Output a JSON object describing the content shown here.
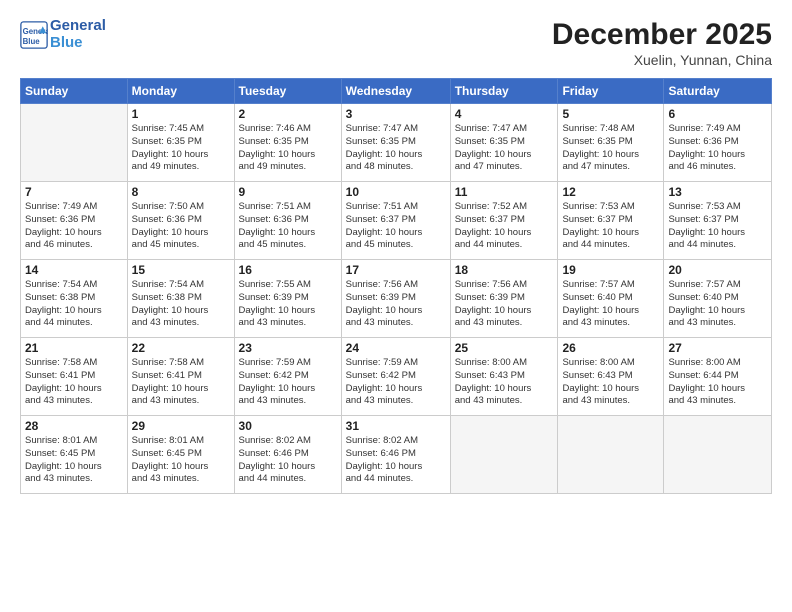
{
  "header": {
    "logo_line1": "General",
    "logo_line2": "Blue",
    "title": "December 2025",
    "location": "Xuelin, Yunnan, China"
  },
  "weekdays": [
    "Sunday",
    "Monday",
    "Tuesday",
    "Wednesday",
    "Thursday",
    "Friday",
    "Saturday"
  ],
  "weeks": [
    [
      {
        "day": "",
        "info": ""
      },
      {
        "day": "1",
        "info": "Sunrise: 7:45 AM\nSunset: 6:35 PM\nDaylight: 10 hours\nand 49 minutes."
      },
      {
        "day": "2",
        "info": "Sunrise: 7:46 AM\nSunset: 6:35 PM\nDaylight: 10 hours\nand 49 minutes."
      },
      {
        "day": "3",
        "info": "Sunrise: 7:47 AM\nSunset: 6:35 PM\nDaylight: 10 hours\nand 48 minutes."
      },
      {
        "day": "4",
        "info": "Sunrise: 7:47 AM\nSunset: 6:35 PM\nDaylight: 10 hours\nand 47 minutes."
      },
      {
        "day": "5",
        "info": "Sunrise: 7:48 AM\nSunset: 6:35 PM\nDaylight: 10 hours\nand 47 minutes."
      },
      {
        "day": "6",
        "info": "Sunrise: 7:49 AM\nSunset: 6:36 PM\nDaylight: 10 hours\nand 46 minutes."
      }
    ],
    [
      {
        "day": "7",
        "info": "Sunrise: 7:49 AM\nSunset: 6:36 PM\nDaylight: 10 hours\nand 46 minutes."
      },
      {
        "day": "8",
        "info": "Sunrise: 7:50 AM\nSunset: 6:36 PM\nDaylight: 10 hours\nand 45 minutes."
      },
      {
        "day": "9",
        "info": "Sunrise: 7:51 AM\nSunset: 6:36 PM\nDaylight: 10 hours\nand 45 minutes."
      },
      {
        "day": "10",
        "info": "Sunrise: 7:51 AM\nSunset: 6:37 PM\nDaylight: 10 hours\nand 45 minutes."
      },
      {
        "day": "11",
        "info": "Sunrise: 7:52 AM\nSunset: 6:37 PM\nDaylight: 10 hours\nand 44 minutes."
      },
      {
        "day": "12",
        "info": "Sunrise: 7:53 AM\nSunset: 6:37 PM\nDaylight: 10 hours\nand 44 minutes."
      },
      {
        "day": "13",
        "info": "Sunrise: 7:53 AM\nSunset: 6:37 PM\nDaylight: 10 hours\nand 44 minutes."
      }
    ],
    [
      {
        "day": "14",
        "info": "Sunrise: 7:54 AM\nSunset: 6:38 PM\nDaylight: 10 hours\nand 44 minutes."
      },
      {
        "day": "15",
        "info": "Sunrise: 7:54 AM\nSunset: 6:38 PM\nDaylight: 10 hours\nand 43 minutes."
      },
      {
        "day": "16",
        "info": "Sunrise: 7:55 AM\nSunset: 6:39 PM\nDaylight: 10 hours\nand 43 minutes."
      },
      {
        "day": "17",
        "info": "Sunrise: 7:56 AM\nSunset: 6:39 PM\nDaylight: 10 hours\nand 43 minutes."
      },
      {
        "day": "18",
        "info": "Sunrise: 7:56 AM\nSunset: 6:39 PM\nDaylight: 10 hours\nand 43 minutes."
      },
      {
        "day": "19",
        "info": "Sunrise: 7:57 AM\nSunset: 6:40 PM\nDaylight: 10 hours\nand 43 minutes."
      },
      {
        "day": "20",
        "info": "Sunrise: 7:57 AM\nSunset: 6:40 PM\nDaylight: 10 hours\nand 43 minutes."
      }
    ],
    [
      {
        "day": "21",
        "info": "Sunrise: 7:58 AM\nSunset: 6:41 PM\nDaylight: 10 hours\nand 43 minutes."
      },
      {
        "day": "22",
        "info": "Sunrise: 7:58 AM\nSunset: 6:41 PM\nDaylight: 10 hours\nand 43 minutes."
      },
      {
        "day": "23",
        "info": "Sunrise: 7:59 AM\nSunset: 6:42 PM\nDaylight: 10 hours\nand 43 minutes."
      },
      {
        "day": "24",
        "info": "Sunrise: 7:59 AM\nSunset: 6:42 PM\nDaylight: 10 hours\nand 43 minutes."
      },
      {
        "day": "25",
        "info": "Sunrise: 8:00 AM\nSunset: 6:43 PM\nDaylight: 10 hours\nand 43 minutes."
      },
      {
        "day": "26",
        "info": "Sunrise: 8:00 AM\nSunset: 6:43 PM\nDaylight: 10 hours\nand 43 minutes."
      },
      {
        "day": "27",
        "info": "Sunrise: 8:00 AM\nSunset: 6:44 PM\nDaylight: 10 hours\nand 43 minutes."
      }
    ],
    [
      {
        "day": "28",
        "info": "Sunrise: 8:01 AM\nSunset: 6:45 PM\nDaylight: 10 hours\nand 43 minutes."
      },
      {
        "day": "29",
        "info": "Sunrise: 8:01 AM\nSunset: 6:45 PM\nDaylight: 10 hours\nand 43 minutes."
      },
      {
        "day": "30",
        "info": "Sunrise: 8:02 AM\nSunset: 6:46 PM\nDaylight: 10 hours\nand 44 minutes."
      },
      {
        "day": "31",
        "info": "Sunrise: 8:02 AM\nSunset: 6:46 PM\nDaylight: 10 hours\nand 44 minutes."
      },
      {
        "day": "",
        "info": ""
      },
      {
        "day": "",
        "info": ""
      },
      {
        "day": "",
        "info": ""
      }
    ]
  ]
}
